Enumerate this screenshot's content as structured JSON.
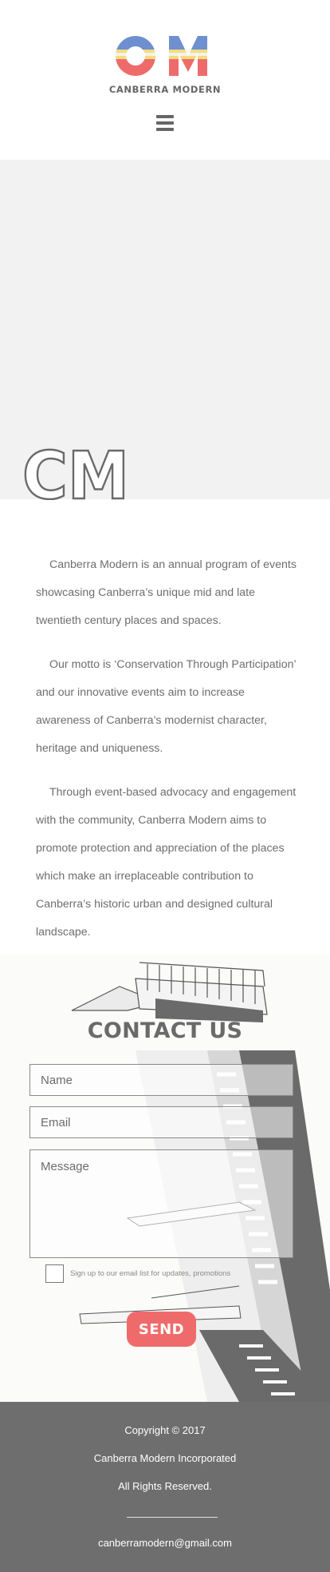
{
  "header": {
    "logo_caption": "CANBERRA MODERN",
    "menu_icon": "hamburger-menu-icon",
    "brand_colors": {
      "blue": "#6e8fd0",
      "yellow": "#f4dd7a",
      "red": "#ee6b6b"
    }
  },
  "hero": {
    "mark_text": "CM"
  },
  "intro": {
    "paragraphs": [
      "Canberra Modern is an annual program of events showcasing Canberra’s unique mid and late twentieth century places and spaces.",
      "Our motto is ‘Conservation Through Participation’ and our innovative events aim to increase awareness of Canberra’s modernist character, heritage and uniqueness.",
      "Through event-based advocacy and engagement with the community, Canberra Modern aims to promote protection and appreciation of the places which make an irreplaceable contribution to Canberra’s historic urban and designed cultural landscape."
    ]
  },
  "contact": {
    "title": "CONTACT US",
    "name_placeholder": "Name",
    "email_placeholder": "Email",
    "message_placeholder": "Message",
    "signup_label": "Sign up to our email list for updates, promotions",
    "send_label": "SEND",
    "send_color": "#ef6b6b"
  },
  "footer": {
    "copyright": "Copyright © 2017",
    "org": "Canberra Modern Incorporated",
    "rights": "All Rights Reserved.",
    "email": "canberramodern@gmail.com"
  }
}
